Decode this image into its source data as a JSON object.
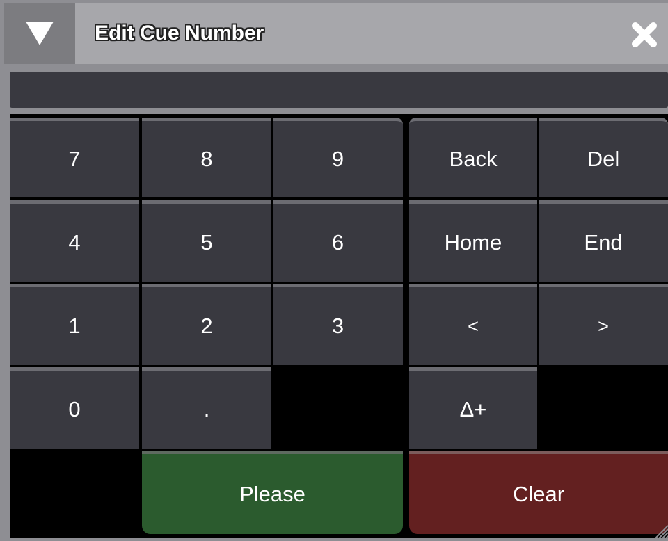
{
  "window": {
    "title": "Edit Cue Number",
    "menu_icon": "triangle-down-icon",
    "close_icon": "close-icon"
  },
  "input": {
    "value": ""
  },
  "numpad": {
    "rows": [
      [
        "7",
        "8",
        "9"
      ],
      [
        "4",
        "5",
        "6"
      ],
      [
        "1",
        "2",
        "3"
      ],
      [
        "0",
        "."
      ]
    ]
  },
  "edit_keys": {
    "back": "Back",
    "del": "Del",
    "home": "Home",
    "end": "End",
    "left": "<",
    "right": ">",
    "delta_plus": "Δ+"
  },
  "actions": {
    "please": "Please",
    "clear": "Clear"
  },
  "colors": {
    "please_bg": "#2b5b2e",
    "clear_bg": "#632020",
    "key_bg": "#393940",
    "titlebar_bg": "#a7a7ab"
  }
}
